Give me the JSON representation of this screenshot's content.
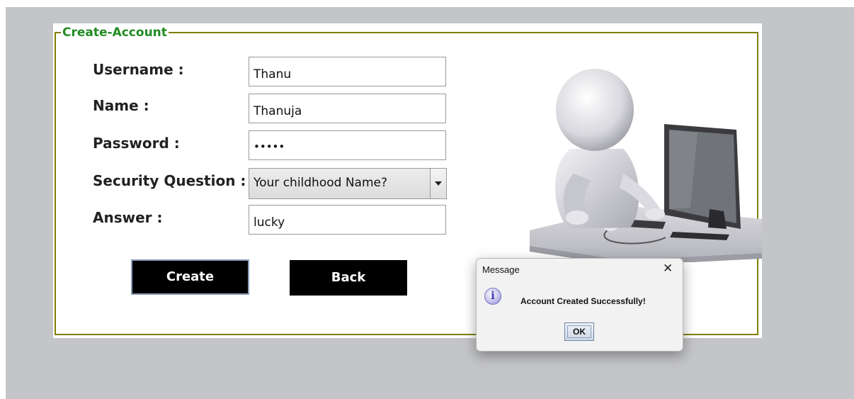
{
  "form": {
    "legend": "Create-Account",
    "labels": {
      "username": "Username :",
      "name": "Name :",
      "password": "Password :",
      "security_question": "Security Question :",
      "answer": "Answer :"
    },
    "values": {
      "username": "Thanu",
      "name": "Thanuja",
      "password": "•••••",
      "security_question": "Your childhood Name?",
      "answer": "lucky"
    },
    "buttons": {
      "create": "Create",
      "back": "Back"
    },
    "colors": {
      "legend": "#228b22",
      "border": "#7f7f00",
      "button_bg": "#000000"
    }
  },
  "dialog": {
    "title": "Message",
    "close": "✕",
    "message": "Account Created Successfully!",
    "ok": "OK",
    "icon": "info-icon"
  }
}
